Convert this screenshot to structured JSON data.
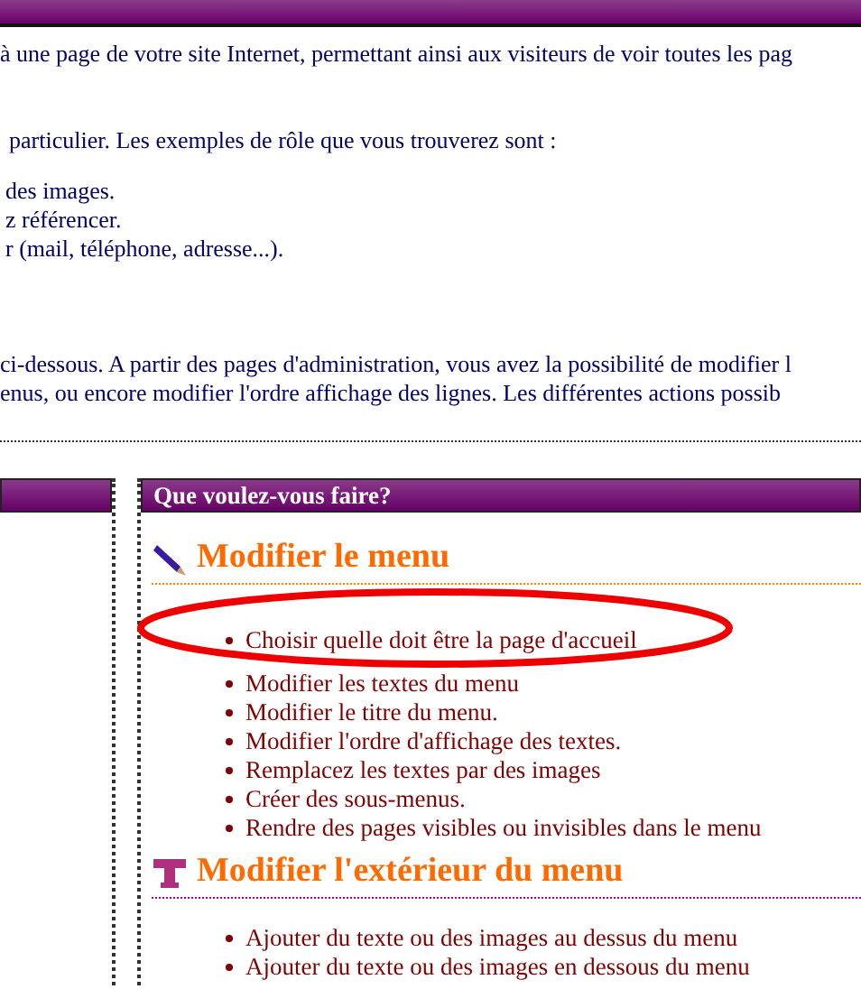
{
  "intro_lines": [
    "à une page de votre site Internet, permettant ainsi aux visiteurs de voir toutes les pag",
    "particulier. Les exemples de rôle que vous trouverez sont :"
  ],
  "role_lines": [
    "des images.",
    "z référencer.",
    "r (mail, téléphone, adresse...)."
  ],
  "admin_lines": [
    "ci-dessous. A partir des pages d'administration, vous avez la possibilité de modifier l",
    "enus, ou encore modifier l'ordre affichage des lignes. Les différentes actions possib"
  ],
  "panel": {
    "title": "Que voulez-vous faire?"
  },
  "sections": [
    {
      "kind": "pencil",
      "title": "Modifier le menu",
      "items": [
        "Choisir quelle doit être la page d'accueil",
        "Modifier les textes du menu",
        "Modifier le titre du menu.",
        "Modifier l'ordre d'affichage des textes.",
        "Remplacez les textes par des images",
        "Créer des sous-menus.",
        "Rendre des pages visibles ou invisibles dans le menu"
      ]
    },
    {
      "kind": "text",
      "title": "Modifier l'extérieur du menu",
      "items": [
        "Ajouter du texte ou des images au dessus du menu",
        "Ajouter du texte ou des images en dessous du menu"
      ]
    }
  ],
  "annotation": {
    "kind": "ellipse"
  }
}
